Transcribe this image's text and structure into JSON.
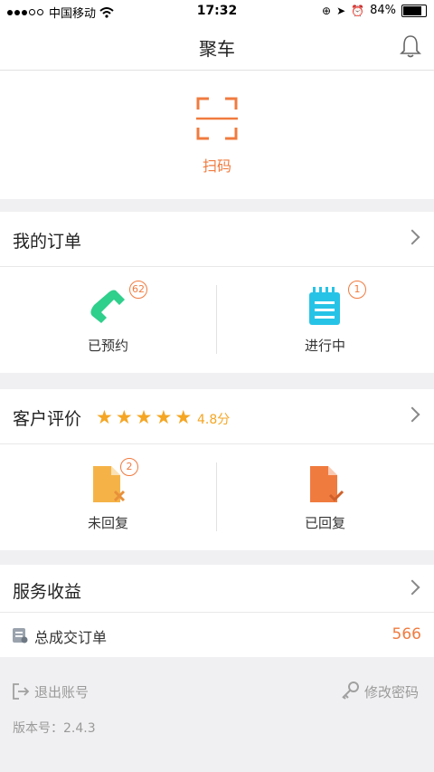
{
  "status_bar": {
    "carrier": "中国移动",
    "time": "17:32",
    "battery": "84%"
  },
  "navbar": {
    "title": "聚车"
  },
  "scan": {
    "label": "扫码"
  },
  "orders": {
    "title": "我的订单",
    "items": [
      {
        "label": "已预约",
        "badge": "62"
      },
      {
        "label": "进行中",
        "badge": "1"
      }
    ]
  },
  "reviews": {
    "title": "客户评价",
    "rating": 5,
    "score": "4.8分",
    "items": [
      {
        "label": "未回复",
        "badge": "2"
      },
      {
        "label": "已回复"
      }
    ]
  },
  "earnings": {
    "title": "服务收益",
    "row_label": "总成交订单",
    "row_value": "566"
  },
  "footer": {
    "logout": "退出账号",
    "change_password": "修改密码",
    "version": "版本号：2.4.3"
  },
  "colors": {
    "accent": "#f07b3f",
    "star": "#f5a623",
    "green": "#2fcf8c",
    "cyan": "#27c3e6"
  }
}
